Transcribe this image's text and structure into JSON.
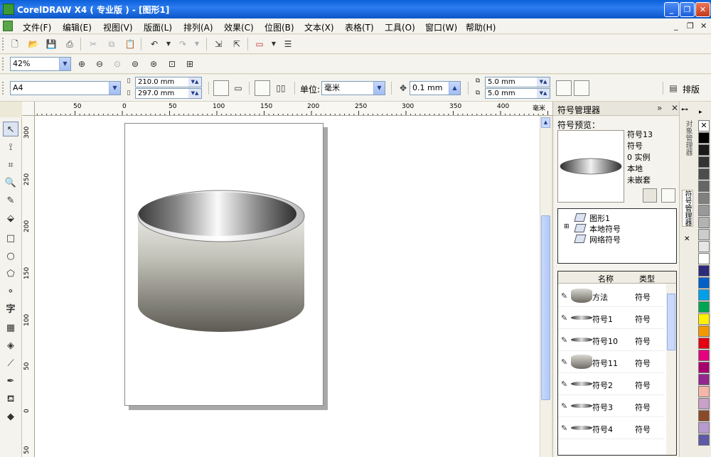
{
  "window": {
    "title": "CorelDRAW X4 ( 专业版 ) - [图形1]",
    "min_label": "_",
    "max_label": "❐",
    "close_label": "✕"
  },
  "menu": {
    "items": [
      "文件(F)",
      "编辑(E)",
      "视图(V)",
      "版面(L)",
      "排列(A)",
      "效果(C)",
      "位图(B)",
      "文本(X)",
      "表格(T)",
      "工具(O)",
      "窗口(W)",
      "帮助(H)"
    ],
    "mdi_min": "_",
    "mdi_restore": "❐",
    "mdi_close": "✕"
  },
  "zoom": {
    "value": "42%"
  },
  "property_bar": {
    "page_size": "A4",
    "width": "210.0 mm",
    "height": "297.0 mm",
    "units_label": "单位:",
    "units_value": "毫米",
    "nudge": "0.1 mm",
    "dup_x": "5.0 mm",
    "dup_y": "5.0 mm",
    "arrange_label": "排版"
  },
  "ruler": {
    "top_ticks": [
      "50",
      "0",
      "50",
      "100",
      "150",
      "200",
      "250",
      "300",
      "350",
      "400"
    ],
    "top_unit": "毫米",
    "left_ticks": [
      "300",
      "250",
      "200",
      "150",
      "100",
      "50",
      "0",
      "50"
    ]
  },
  "docker": {
    "title": "符号管理器",
    "preview_label": "符号预览：",
    "info": [
      "符号13",
      "符号",
      "0 实例",
      "本地",
      "未嵌套"
    ],
    "tree": [
      "图形1",
      "本地符号",
      "网络符号"
    ],
    "list_headers": {
      "name": "名称",
      "type": "类型"
    },
    "rows": [
      {
        "name": "方法",
        "type": "符号"
      },
      {
        "name": "符号1",
        "type": "符号"
      },
      {
        "name": "符号10",
        "type": "符号"
      },
      {
        "name": "符号11",
        "type": "符号"
      },
      {
        "name": "符号2",
        "type": "符号"
      },
      {
        "name": "符号3",
        "type": "符号"
      },
      {
        "name": "符号4",
        "type": "符号"
      }
    ]
  },
  "side_tabs": [
    "对象管理器",
    "符号管理器"
  ],
  "palette": [
    "#ffffff",
    "#000000",
    "#1a1a1a",
    "#333333",
    "#4d4d4d",
    "#666666",
    "#808080",
    "#999999",
    "#b3b3b3",
    "#cccccc",
    "#e6e6e6",
    "#ffffff",
    "#2e2a7a",
    "#0061c9",
    "#00a0e9",
    "#00a651",
    "#fff100",
    "#f39800",
    "#e60012",
    "#e4007f",
    "#a8006f",
    "#92278f",
    "#f5b5a8",
    "#c8a0c8",
    "#8a4a2a",
    "#b89ad0",
    "#5e5aa6"
  ]
}
